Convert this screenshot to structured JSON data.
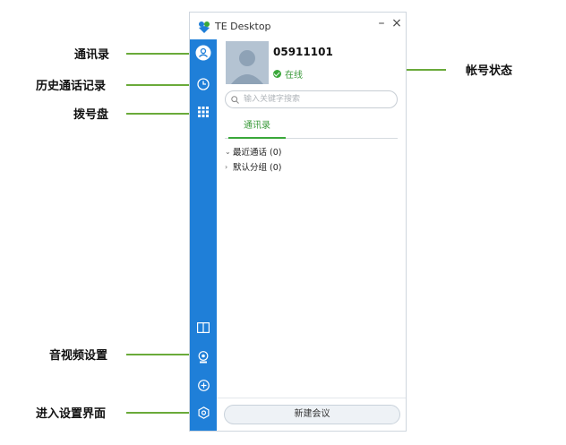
{
  "window": {
    "title": "TE Desktop",
    "minimize_glyph": "–",
    "close_glyph": "×"
  },
  "profile": {
    "account_id": "05911101",
    "status_text": "在线"
  },
  "search": {
    "placeholder": "输入关键字搜索"
  },
  "tabs": [
    {
      "label": "通讯录"
    }
  ],
  "groups": [
    {
      "chevron": "⌄",
      "label": "最近通话 (0)"
    },
    {
      "chevron": "›",
      "label": "默认分组 (0)"
    }
  ],
  "bottom": {
    "new_meeting_label": "新建会议"
  },
  "sidebar": {
    "icons": [
      "contacts-icon",
      "history-icon",
      "dialpad-icon",
      "book-icon",
      "webcam-icon",
      "add-icon",
      "settings-icon"
    ]
  },
  "annotations": {
    "contacts": "通讯录",
    "history": "历史通话记录",
    "dialpad": "拨号盘",
    "account_status": "帐号状态",
    "av_settings": "音视频设置",
    "enter_settings": "进入设置界面"
  },
  "colors": {
    "sidebar_blue": "#1f7fd8",
    "annotation_green": "#6aaa3a",
    "online_green": "#3aa83a"
  }
}
